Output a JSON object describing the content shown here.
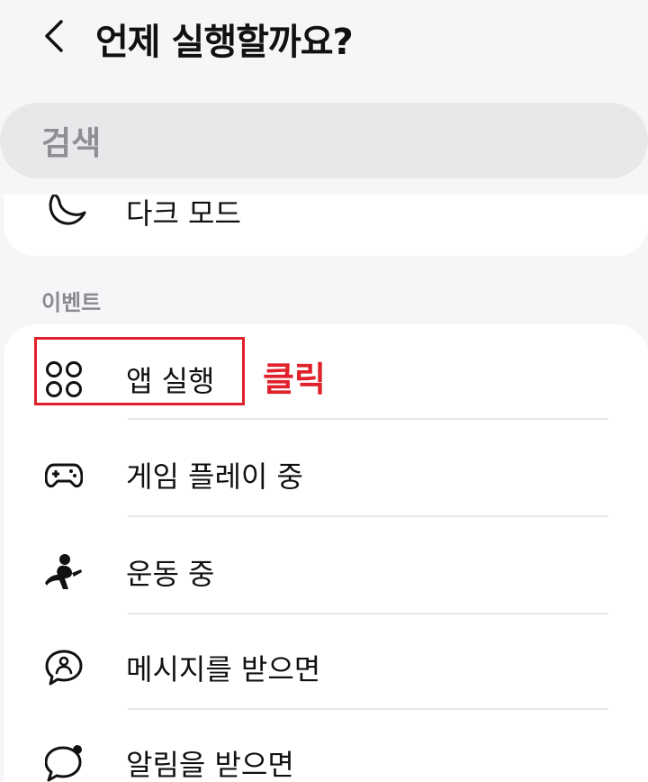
{
  "header": {
    "title": "언제 실행할까요?"
  },
  "search": {
    "placeholder": "검색"
  },
  "top_item": {
    "label": "다크 모드",
    "icon": "moon-icon"
  },
  "section": {
    "title": "이벤트"
  },
  "events": [
    {
      "label": "앱 실행",
      "icon": "apps-icon"
    },
    {
      "label": "게임 플레이 중",
      "icon": "gamepad-icon"
    },
    {
      "label": "운동 중",
      "icon": "running-icon"
    },
    {
      "label": "메시지를 받으면",
      "icon": "message-icon"
    },
    {
      "label": "알림을 받으면",
      "icon": "notification-bubble-icon"
    }
  ],
  "annotation": {
    "text": "클릭",
    "color": "#e0202a"
  }
}
